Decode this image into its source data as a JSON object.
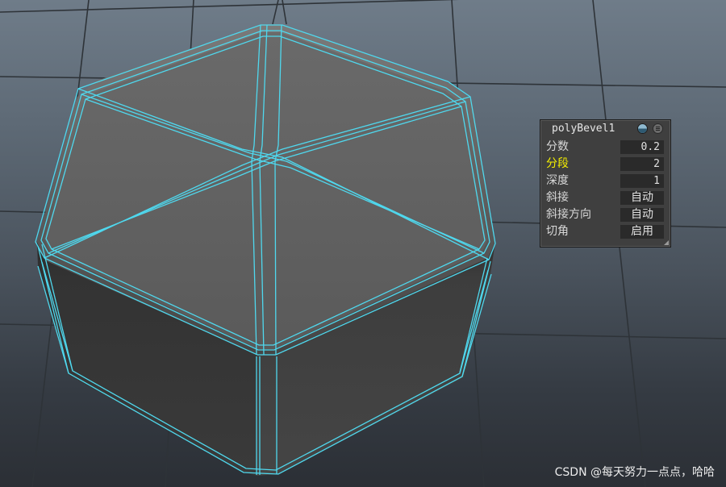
{
  "hud": {
    "title": "polyBevel1",
    "rows": [
      {
        "label": "分数",
        "value": "0.2",
        "highlighted": false
      },
      {
        "label": "分段",
        "value": "2",
        "highlighted": true
      },
      {
        "label": "深度",
        "value": "1",
        "highlighted": false
      },
      {
        "label": "斜接",
        "value": "自动",
        "highlighted": false
      },
      {
        "label": "斜接方向",
        "value": "自动",
        "highlighted": false
      },
      {
        "label": "切角",
        "value": "启用",
        "highlighted": false
      }
    ],
    "icons": [
      "sphere-icon",
      "menu-icon"
    ]
  },
  "watermark": "CSDN @每天努力一点点，哈哈",
  "colors": {
    "wireframe": "#4fd8ee",
    "highlight_label": "#f5f000",
    "hud_bg": "#3f3f3f"
  }
}
